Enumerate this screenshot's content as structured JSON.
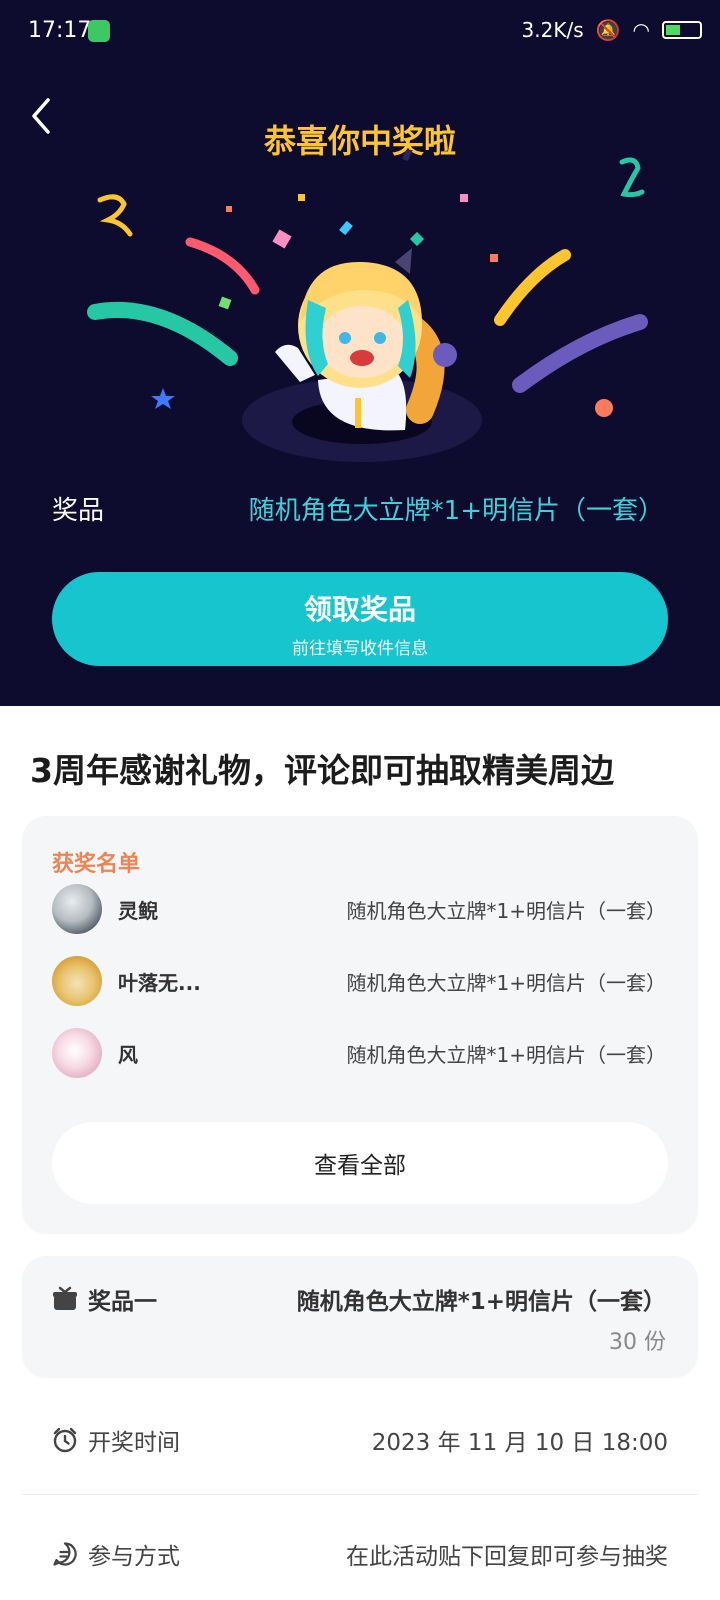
{
  "status_bar": {
    "time": "17:17",
    "speed": "3.2K/s"
  },
  "hero": {
    "title": "恭喜你中奖啦",
    "prize_label": "奖品",
    "prize_value": "随机角色大立牌*1+明信片（一套）",
    "claim_button": {
      "label": "领取奖品",
      "sublabel": "前往填写收件信息"
    }
  },
  "event_title": "3周年感谢礼物，评论即可抽取精美周边",
  "winners": {
    "title": "获奖名单",
    "list": [
      {
        "name": "灵鲵",
        "prize": "随机角色大立牌*1+明信片（一套）"
      },
      {
        "name": "叶落无...",
        "prize": "随机角色大立牌*1+明信片（一套）"
      },
      {
        "name": "风",
        "prize": "随机角色大立牌*1+明信片（一套）"
      }
    ],
    "see_all_label": "查看全部"
  },
  "prize_detail": {
    "label": "奖品一",
    "value": "随机角色大立牌*1+明信片（一套）",
    "count": "30 份"
  },
  "draw_time": {
    "label": "开奖时间",
    "value": "2023 年 11 月 10 日 18:00"
  },
  "participation": {
    "label": "参与方式",
    "value": "在此活动贴下回复即可参与抽奖"
  },
  "colors": {
    "hero_bg": "#0d0b2e",
    "accent_teal": "#16c5cd",
    "title_gold": "#ffc531",
    "winners_orange": "#f08353"
  }
}
